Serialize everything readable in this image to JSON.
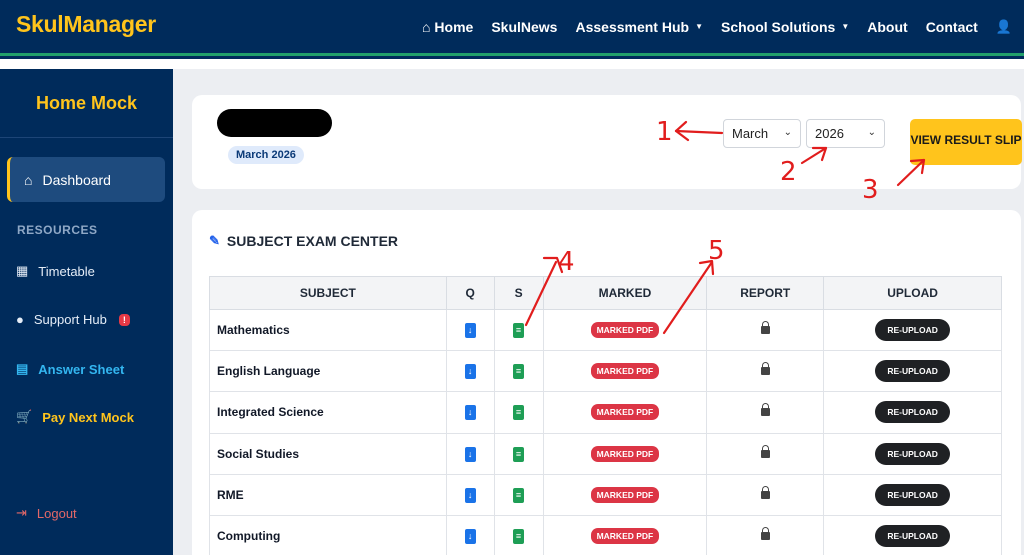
{
  "brand": "SkulManager",
  "nav": {
    "home": "Home",
    "skulnews": "SkulNews",
    "assessment_hub": "Assessment Hub",
    "school_solutions": "School Solutions",
    "about": "About",
    "contact": "Contact"
  },
  "sidebar": {
    "title": "Home Mock",
    "dashboard": "Dashboard",
    "section_resources": "RESOURCES",
    "timetable": "Timetable",
    "support_hub": "Support Hub",
    "support_badge": "!",
    "answer_sheet": "Answer Sheet",
    "pay_next_mock": "Pay Next Mock",
    "logout": "Logout"
  },
  "header": {
    "month_chip": "March 2026",
    "month_select": "March",
    "year_select": "2026",
    "view_result_slip": "VIEW RESULT SLIP"
  },
  "exam_center": {
    "title": "SUBJECT EXAM CENTER",
    "columns": [
      "SUBJECT",
      "Q",
      "S",
      "MARKED",
      "REPORT",
      "UPLOAD"
    ],
    "marked_label": "MARKED PDF",
    "upload_label": "RE-UPLOAD",
    "rows": [
      {
        "subject": "Mathematics"
      },
      {
        "subject": "English Language"
      },
      {
        "subject": "Integrated Science"
      },
      {
        "subject": "Social Studies"
      },
      {
        "subject": "RME"
      },
      {
        "subject": "Computing"
      }
    ]
  },
  "annotations": {
    "a1": "1",
    "a2": "2",
    "a3": "3",
    "a4": "4",
    "a5": "5"
  },
  "colors": {
    "navy": "#002b5b",
    "accent_yellow": "#ffc41c",
    "nav_underline": "#22a06b",
    "danger": "#dc3545",
    "annotation_red": "#e11d1d"
  }
}
